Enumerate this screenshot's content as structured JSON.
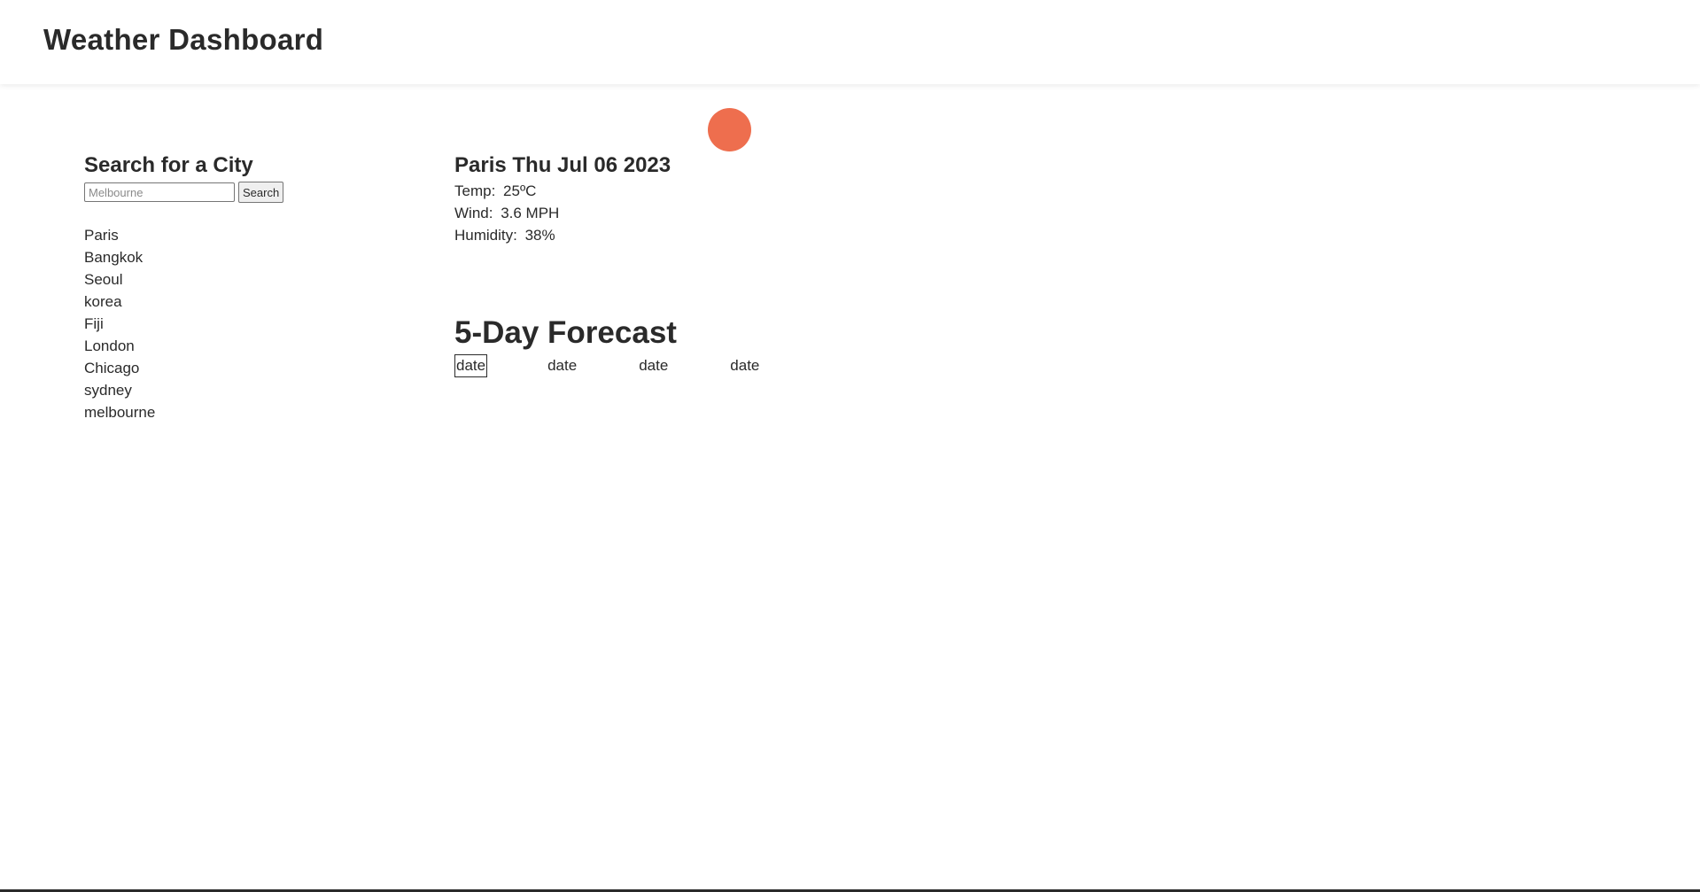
{
  "header": {
    "title": "Weather Dashboard"
  },
  "search": {
    "heading": "Search for a City",
    "placeholder": "Melbourne",
    "button_label": "Search",
    "history": [
      "Paris",
      "Bangkok",
      "Seoul",
      "korea",
      "Fiji",
      "London",
      "Chicago",
      "sydney",
      "melbourne"
    ]
  },
  "current": {
    "heading": "Paris Thu Jul 06 2023",
    "temp_label": "Temp:",
    "temp_value": "25ºC",
    "wind_label": "Wind:",
    "wind_value": "3.6 MPH",
    "humidity_label": "Humidity:",
    "humidity_value": "38%"
  },
  "forecast": {
    "heading": "5-Day Forecast",
    "dates": [
      "date",
      "date",
      "date",
      "date"
    ]
  },
  "colors": {
    "accent_dot": "#ee6e4e",
    "text": "#2a2a2a",
    "background": "#ffffff"
  }
}
